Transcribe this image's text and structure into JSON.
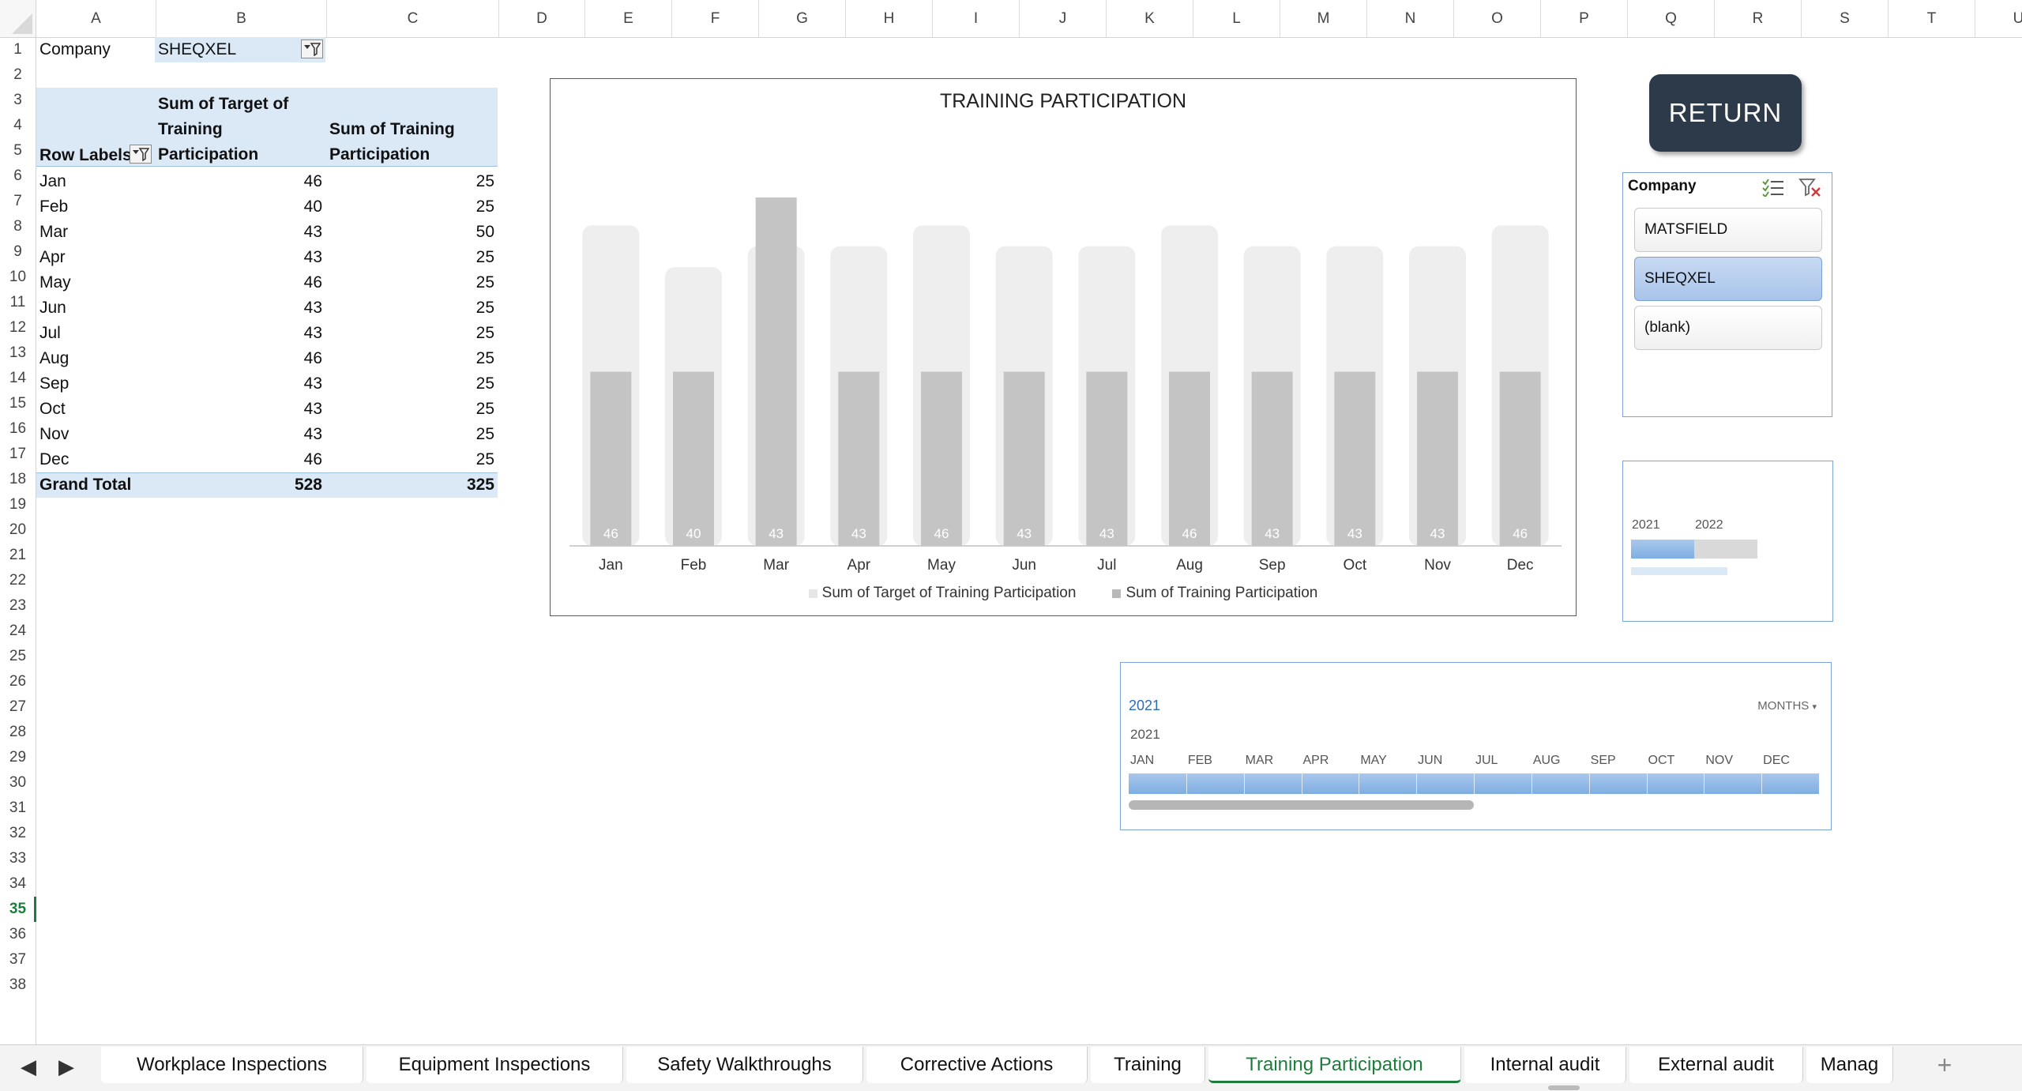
{
  "columns": [
    "A",
    "B",
    "C",
    "D",
    "E",
    "F",
    "G",
    "H",
    "I",
    "J",
    "K",
    "L",
    "M",
    "N",
    "O",
    "P",
    "Q",
    "R",
    "S",
    "T",
    "U"
  ],
  "rows": [
    "1",
    "2",
    "3",
    "4",
    "5",
    "6",
    "7",
    "8",
    "9",
    "10",
    "11",
    "12",
    "13",
    "14",
    "15",
    "16",
    "17",
    "18",
    "19",
    "20",
    "21",
    "22",
    "23",
    "24",
    "25",
    "26",
    "27",
    "28",
    "29",
    "30",
    "31",
    "32",
    "33",
    "34",
    "35",
    "36",
    "37",
    "38"
  ],
  "selected_row": "35",
  "pivot": {
    "filter_label": "Company",
    "filter_value": "SHEQXEL",
    "row_labels_header": "Row Labels",
    "col_b_header": "Sum of Target of Training Participation",
    "col_c_header": "Sum of Training Participation",
    "rows": [
      {
        "label": "Jan",
        "target": "46",
        "actual": "25"
      },
      {
        "label": "Feb",
        "target": "40",
        "actual": "25"
      },
      {
        "label": "Mar",
        "target": "43",
        "actual": "50"
      },
      {
        "label": "Apr",
        "target": "43",
        "actual": "25"
      },
      {
        "label": "May",
        "target": "46",
        "actual": "25"
      },
      {
        "label": "Jun",
        "target": "43",
        "actual": "25"
      },
      {
        "label": "Jul",
        "target": "43",
        "actual": "25"
      },
      {
        "label": "Aug",
        "target": "46",
        "actual": "25"
      },
      {
        "label": "Sep",
        "target": "43",
        "actual": "25"
      },
      {
        "label": "Oct",
        "target": "43",
        "actual": "25"
      },
      {
        "label": "Nov",
        "target": "43",
        "actual": "25"
      },
      {
        "label": "Dec",
        "target": "46",
        "actual": "25"
      }
    ],
    "grand_total_label": "Grand Total",
    "grand_total_target": "528",
    "grand_total_actual": "325"
  },
  "chart_data": {
    "type": "bar",
    "title": "TRAINING PARTICIPATION",
    "categories": [
      "Jan",
      "Feb",
      "Mar",
      "Apr",
      "May",
      "Jun",
      "Jul",
      "Aug",
      "Sep",
      "Oct",
      "Nov",
      "Dec"
    ],
    "series": [
      {
        "name": "Sum of Target of Training Participation",
        "values": [
          46,
          40,
          43,
          43,
          46,
          43,
          43,
          46,
          43,
          43,
          43,
          46
        ],
        "color": "#eeeeee"
      },
      {
        "name": "Sum of Training Participation",
        "values": [
          25,
          25,
          50,
          25,
          25,
          25,
          25,
          25,
          25,
          25,
          25,
          25
        ],
        "color": "#c4c4c4"
      }
    ],
    "data_labels_series": "Sum of Target of Training Participation",
    "ylim": [
      0,
      50
    ],
    "grid": false,
    "legend_position": "bottom",
    "xlabel": "",
    "ylabel": ""
  },
  "return_button": "RETURN",
  "slicer": {
    "title": "Company",
    "items": [
      {
        "label": "MATSFIELD",
        "selected": false
      },
      {
        "label": "SHEQXEL",
        "selected": true
      },
      {
        "label": "(blank)",
        "selected": false
      }
    ]
  },
  "timeline_small": {
    "years": [
      "2021",
      "2022"
    ]
  },
  "timeline": {
    "selected_label": "2021",
    "level_label": "MONTHS",
    "year": "2021",
    "months": [
      "JAN",
      "FEB",
      "MAR",
      "APR",
      "MAY",
      "JUN",
      "JUL",
      "AUG",
      "SEP",
      "OCT",
      "NOV",
      "DEC"
    ]
  },
  "sheet_tabs": [
    {
      "label": "Workplace Inspections",
      "active": false
    },
    {
      "label": "Equipment Inspections",
      "active": false
    },
    {
      "label": "Safety Walkthroughs",
      "active": false
    },
    {
      "label": "Corrective Actions",
      "active": false
    },
    {
      "label": "Training",
      "active": false
    },
    {
      "label": "Training Participation",
      "active": true
    },
    {
      "label": "Internal audit",
      "active": false
    },
    {
      "label": "External audit",
      "active": false
    },
    {
      "label": "Manag",
      "active": false
    }
  ],
  "colors": {
    "accent_green": "#1d7d3c",
    "header_blue": "#dbe9f7",
    "return_bg": "#2d3a4a",
    "slicer_border": "#7aa5d6"
  }
}
